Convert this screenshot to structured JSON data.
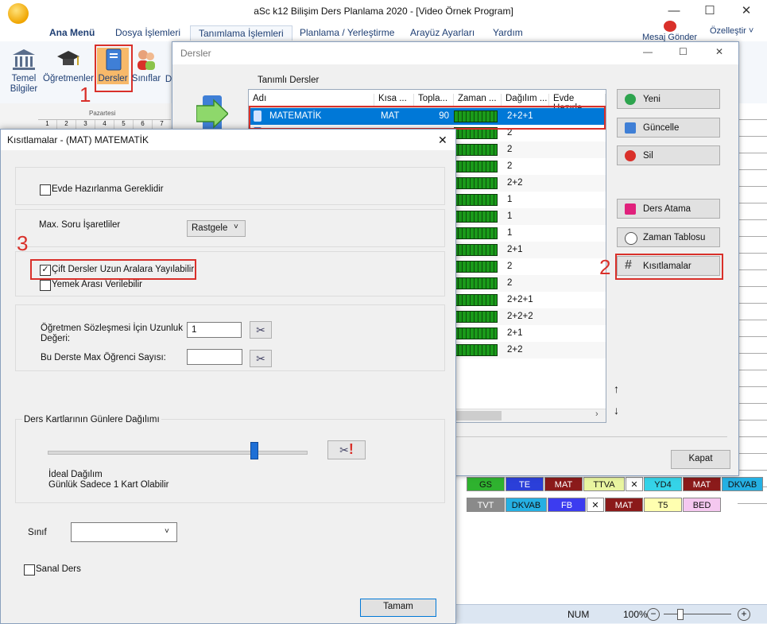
{
  "app": {
    "title": "aSc k12 Bilişim Ders Planlama 2020  - [Video Örnek Program]",
    "window_controls": {
      "minimize": "—",
      "maximize": "☐",
      "close": "✕"
    }
  },
  "menubar": {
    "items": [
      "Ana Menü",
      "Dosya İşlemleri",
      "Tanımlama İşlemleri",
      "Planlama / Yerleştirme",
      "Arayüz Ayarları",
      "Yardım"
    ],
    "active": "Tanımlama İşlemleri",
    "right_items": {
      "mesaj": "Mesaj Gönder",
      "ozellestir": "Özelleştir ˅"
    }
  },
  "ribbon": {
    "temel_line1": "Temel",
    "temel_line2": "Bilgiler",
    "ogretmenler": "Öğretmenler",
    "dersler": "Dersler",
    "siniflar": "Sınıflar",
    "derslikler_partial": "D"
  },
  "annotations": {
    "n1": "1",
    "n2": "2",
    "n3": "3"
  },
  "schedule": {
    "day_header": "Pazartesi",
    "period_numbers": [
      "1",
      "2",
      "3",
      "4",
      "5",
      "6",
      "7"
    ],
    "row1": [
      {
        "t": "GS",
        "bg": "#2fb22f"
      },
      {
        "t": "TE",
        "bg": "#2b3fd9"
      },
      {
        "t": "MAT",
        "bg": "#8b1a1a"
      },
      {
        "t": "TTVA",
        "bg": "#e9f5a0"
      },
      {
        "t": "✕",
        "bg": "#ffffff"
      },
      {
        "t": "YD4",
        "bg": "#35d3e8"
      },
      {
        "t": "MAT",
        "bg": "#8b1a1a"
      },
      {
        "t": "DKVAB",
        "bg": "#25b0e3"
      }
    ],
    "row2": [
      {
        "t": "TVT",
        "bg": "#8a8a8a"
      },
      {
        "t": "DKVAB",
        "bg": "#25b0e3"
      },
      {
        "t": "FB",
        "bg": "#3c3cf0"
      },
      {
        "t": "✕",
        "bg": "#ffffff"
      },
      {
        "t": "MAT",
        "bg": "#8b1a1a"
      },
      {
        "t": "T5",
        "bg": "#ffffb0"
      },
      {
        "t": "BED",
        "bg": "#f5c8f0"
      }
    ]
  },
  "statusbar": {
    "num": "NUM",
    "zoom": "100%"
  },
  "dersler": {
    "title": "Dersler",
    "list_label": "Tanımlı Dersler",
    "columns": [
      "Adı",
      "Kısa ...",
      "Topla...",
      "Zaman ...",
      "Dağılım ...",
      "Evde Hazırla"
    ],
    "rows": [
      {
        "name": "MATEMATİK",
        "short": "MAT",
        "total": "90",
        "dist": "2+2+1",
        "selected": true
      },
      {
        "name": "",
        "short": "",
        "total": "",
        "dist": "2"
      },
      {
        "name": "",
        "short": "",
        "total": "",
        "dist": "2"
      },
      {
        "name": "",
        "short": "",
        "total": "",
        "dist": "2"
      },
      {
        "name": "",
        "short": "",
        "total": "",
        "dist": "2+2"
      },
      {
        "name": "",
        "short": "",
        "total": "",
        "dist": "1"
      },
      {
        "name": "",
        "short": "",
        "total": "",
        "dist": "1"
      },
      {
        "name": "",
        "short": "",
        "total": "",
        "dist": "1"
      },
      {
        "name": "",
        "short": "",
        "total": "",
        "dist": "2+1"
      },
      {
        "name": "",
        "short": "",
        "total": "",
        "dist": "2"
      },
      {
        "name": "",
        "short": "",
        "total": "",
        "dist": "2"
      },
      {
        "name": "",
        "short": "",
        "total": "",
        "dist": "2+2+1"
      },
      {
        "name": "",
        "short": "",
        "total": "",
        "dist": "2+2+2"
      },
      {
        "name": "",
        "short": "",
        "total": "",
        "dist": "2+1"
      },
      {
        "name": "",
        "short": "",
        "total": "",
        "dist": "2+2"
      }
    ],
    "buttons": {
      "yeni": "Yeni",
      "guncelle": "Güncelle",
      "sil": "Sil",
      "ders_atama": "Ders Atama",
      "zaman_tablosu": "Zaman Tablosu",
      "kisitlamalar": "Kısıtlamalar",
      "kapat": "Kapat"
    },
    "arrows": {
      "up": "↑",
      "down": "↓"
    }
  },
  "kisit": {
    "title": "Kısıtlamalar - (MAT) MATEMATİK",
    "evde": {
      "label": "Evde Hazırlanma Gereklidir",
      "checked": false
    },
    "max_soru": {
      "label": "Max. Soru İşaretliler",
      "value": "Rastgele"
    },
    "cift": {
      "label": "Çift Dersler Uzun Aralara Yayılabilir",
      "checked": true
    },
    "yemek": {
      "label": "Yemek Arası Verilebilir",
      "checked": false
    },
    "sozlesme": {
      "label_line1": "Öğretmen Sözleşmesi İçin Uzunluk",
      "label_line2": "Değeri:",
      "value": "1"
    },
    "max_ogrenci": {
      "label": "Bu Derste Max Öğrenci Sayısı:",
      "value": ""
    },
    "dagilim": {
      "group_label": "Ders Kartlarının Günlere Dağılımı",
      "slider_level": 0.8,
      "line1": "İdeal Dağılım",
      "line2": "Günlük Sadece 1 Kart Olabilir",
      "warn": "!"
    },
    "sinif": {
      "label": "Sınıf",
      "value": ""
    },
    "sanal": {
      "label": "Sanal Ders",
      "checked": false
    },
    "tamam": "Tamam"
  }
}
